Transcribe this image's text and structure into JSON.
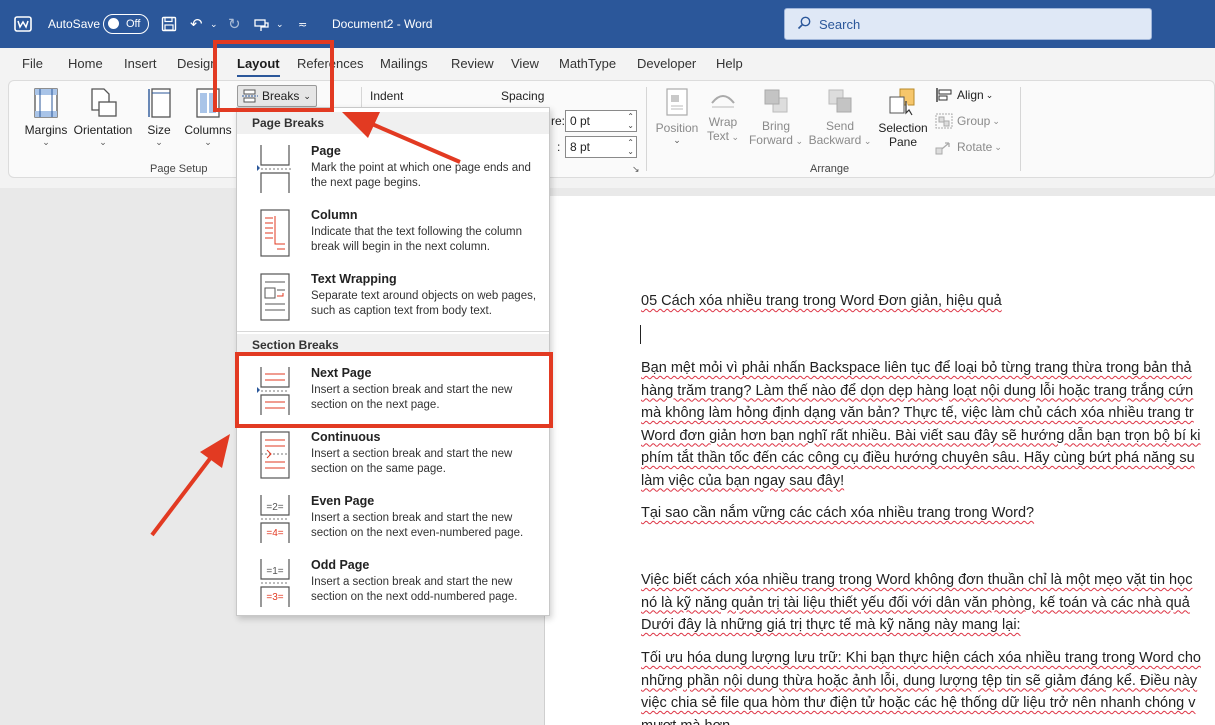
{
  "titlebar": {
    "autosave_label": "AutoSave",
    "autosave_state": "Off",
    "document_title": "Document2  -  Word",
    "search_placeholder": "Search"
  },
  "tabs": [
    {
      "label": "File"
    },
    {
      "label": "Home"
    },
    {
      "label": "Insert"
    },
    {
      "label": "Design"
    },
    {
      "label": "Layout"
    },
    {
      "label": "References"
    },
    {
      "label": "Mailings"
    },
    {
      "label": "Review"
    },
    {
      "label": "View"
    },
    {
      "label": "MathType"
    },
    {
      "label": "Developer"
    },
    {
      "label": "Help"
    }
  ],
  "ribbon": {
    "page_setup": {
      "margins": "Margins",
      "orientation": "Orientation",
      "size": "Size",
      "columns": "Columns",
      "group_label": "Page Setup"
    },
    "breaks": "Breaks",
    "paragraph": {
      "indent": "Indent",
      "spacing": "Spacing",
      "before_label": "re:",
      "before_value": "0 pt",
      "after_label": ":",
      "after_value": "8 pt"
    },
    "arrange": {
      "position": "Position",
      "wrap_1": "Wrap",
      "wrap_2": "Text",
      "bring_1": "Bring",
      "bring_2": "Forward",
      "send_1": "Send",
      "send_2": "Backward",
      "selection_1": "Selection",
      "selection_2": "Pane",
      "align": "Align",
      "group": "Group",
      "rotate": "Rotate",
      "group_label": "Arrange"
    }
  },
  "breaks_menu": {
    "page_breaks_header": "Page Breaks",
    "section_breaks_header": "Section Breaks",
    "items": [
      {
        "title": "Page",
        "desc": "Mark the point at which one page ends and the next page begins."
      },
      {
        "title": "Column",
        "desc": "Indicate that the text following the column break will begin in the next column."
      },
      {
        "title": "Text Wrapping",
        "desc": "Separate text around objects on web pages, such as caption text from body text."
      },
      {
        "title": "Next Page",
        "desc": "Insert a section break and start the new section on the next page."
      },
      {
        "title": "Continuous",
        "desc": "Insert a section break and start the new section on the same page."
      },
      {
        "title": "Even Page",
        "desc": "Insert a section break and start the new section on the next even-numbered page."
      },
      {
        "title": "Odd Page",
        "desc": "Insert a section break and start the new section on the next odd-numbered page."
      }
    ]
  },
  "document": {
    "title_line": "05 Cách xóa nhiều trang trong Word Đơn giản, hiệu quả",
    "para1": [
      "Bạn mệt mỏi vì phải nhấn Backspace liên tục để loại bỏ từng trang thừa trong bản thả",
      "hàng trăm trang? Làm thế nào để dọn dẹp hàng loạt nội dung lỗi hoặc trang trắng cứn",
      "mà không làm hỏng định dạng văn bản? Thực tế, việc làm chủ cách xóa nhiều trang tr",
      "Word đơn giản hơn bạn nghĩ rất nhiều. Bài viết sau đây sẽ hướng dẫn bạn trọn bộ bí ki",
      "phím tắt thần tốc đến các công cụ điều hướng chuyên sâu. Hãy cùng bứt phá năng su",
      "làm việc của bạn ngay sau đây!"
    ],
    "heading2": "Tại sao cần nắm vững các cách xóa nhiều trang trong Word?",
    "para2": [
      "Việc biết cách xóa nhiều trang trong Word không đơn thuần chỉ là một mẹo vặt tin học",
      "nó là kỹ năng quản trị tài liệu thiết yếu đối với dân văn phòng, kế toán và các nhà quả",
      "Dưới đây là những giá trị thực tế mà kỹ năng này mang lại:"
    ],
    "para3": [
      "Tối ưu hóa dung lượng lưu trữ: Khi bạn thực hiện cách xóa nhiều trang trong Word cho",
      "những phần nội dung thừa hoặc ảnh lỗi, dung lượng tệp tin sẽ giảm đáng kể. Điều này",
      "việc chia sẻ file qua hòm thư điện tử hoặc các hệ thống dữ liệu trở nên nhanh chóng v",
      "mượt mà hơn."
    ]
  },
  "colors": {
    "titlebar": "#2b579a",
    "annotation_red": "#e23a22",
    "spellcheck": "#d34"
  }
}
